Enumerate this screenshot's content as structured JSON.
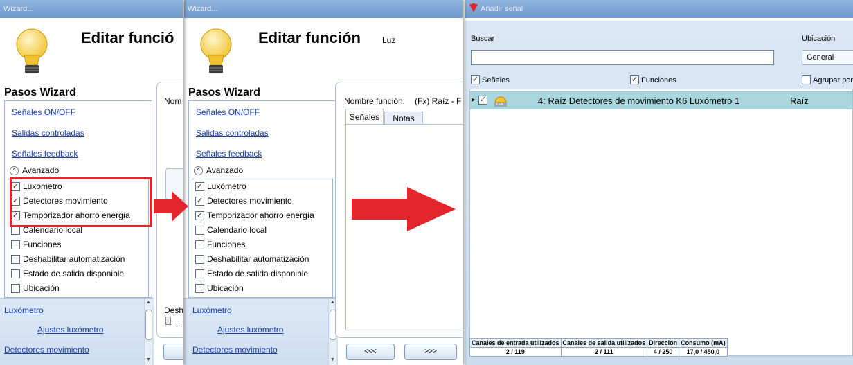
{
  "win1": {
    "title": "Wizard...",
    "heading": "Editar funció",
    "steps_title": "Pasos Wizard",
    "right_label": "Nom",
    "bottom_label": "Desh",
    "links": [
      "Señales ON/OFF",
      "Salidas controladas",
      "Señales feedback"
    ],
    "advanced_label": "Avanzado",
    "checkbox_items": [
      {
        "label": "Luxómetro",
        "checked": true
      },
      {
        "label": "Detectores movimiento",
        "checked": true
      },
      {
        "label": "Temporizador ahorro energía",
        "checked": true
      },
      {
        "label": "Calendario local",
        "checked": false
      },
      {
        "label": "Funciones",
        "checked": false
      },
      {
        "label": "Deshabilitar automatización",
        "checked": false
      },
      {
        "label": "Estado de salida disponible",
        "checked": false
      },
      {
        "label": "Ubicación",
        "checked": false
      }
    ],
    "lower_links": [
      "Luxómetro",
      "Ajustes luxómetro",
      "Detectores movimiento"
    ]
  },
  "win2": {
    "title": "Wizard...",
    "heading": "Editar función",
    "subheading": "Luz",
    "steps_title": "Pasos Wizard",
    "links": [
      "Señales ON/OFF",
      "Salidas controladas",
      "Señales feedback"
    ],
    "advanced_label": "Avanzado",
    "checkbox_items": [
      {
        "label": "Luxómetro",
        "checked": true
      },
      {
        "label": "Detectores movimiento",
        "checked": true
      },
      {
        "label": "Temporizador ahorro energía",
        "checked": true
      },
      {
        "label": "Calendario local",
        "checked": false
      },
      {
        "label": "Funciones",
        "checked": false
      },
      {
        "label": "Deshabilitar automatización",
        "checked": false
      },
      {
        "label": "Estado de salida disponible",
        "checked": false
      },
      {
        "label": "Ubicación",
        "checked": false
      }
    ],
    "lower_links": [
      "Luxómetro",
      "Ajustes luxómetro",
      "Detectores movimiento"
    ],
    "function_name_label": "Nombre función:",
    "function_name_value": "(Fx) Raíz - F",
    "tabs": [
      "Señales",
      "Notas"
    ],
    "prev_button": "<<<",
    "next_button": ">>>"
  },
  "win3": {
    "title": "Añadir señal",
    "search_label": "Buscar",
    "search_value": "",
    "location_label": "Ubicación",
    "location_value": "General",
    "filter_signals": "Señales",
    "filter_functions": "Funciones",
    "group_by": "Agrupar por",
    "row": {
      "text": "4: Raíz Detectores de movimiento K6 Luxómetro 1",
      "location": "Raíz",
      "icon_badge": "LUX"
    },
    "stats": {
      "headers": [
        "Canales de entrada utilizados",
        "Canales de salida utilizados",
        "Dirección",
        "Consumo (mA)"
      ],
      "values": [
        "2 / 119",
        "2 / 111",
        "4 / 250",
        "17,0 / 450,0"
      ]
    }
  },
  "colors": {
    "accent_red": "#e3262b",
    "title_blue": "#7aa3d4",
    "row_teal": "#a9d6df"
  }
}
